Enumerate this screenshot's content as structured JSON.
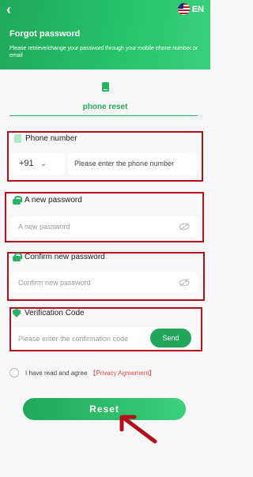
{
  "header": {
    "back_icon": "chevron-left-icon",
    "language": "EN",
    "title": "Forgot password",
    "subtitle": "Please retrieve/change your password through your mobile phone number or email"
  },
  "tab": {
    "label": "phone reset"
  },
  "phone_field": {
    "label": "Phone number",
    "country_code": "+91",
    "placeholder": "Please enter the phone number"
  },
  "new_password": {
    "label": "A new password",
    "placeholder": "A new password"
  },
  "confirm_password": {
    "label": "Confirm new password",
    "placeholder": "Confirm new password"
  },
  "verification": {
    "label": "Verification Code",
    "placeholder": "Please enter the confirmation code",
    "send_label": "Send"
  },
  "agreement": {
    "text": "I have read and agree",
    "link": "【Privacy Agreement】"
  },
  "reset_label": "Reset",
  "colors": {
    "brand_green": "#25b562",
    "highlight_red": "#b3101b"
  }
}
